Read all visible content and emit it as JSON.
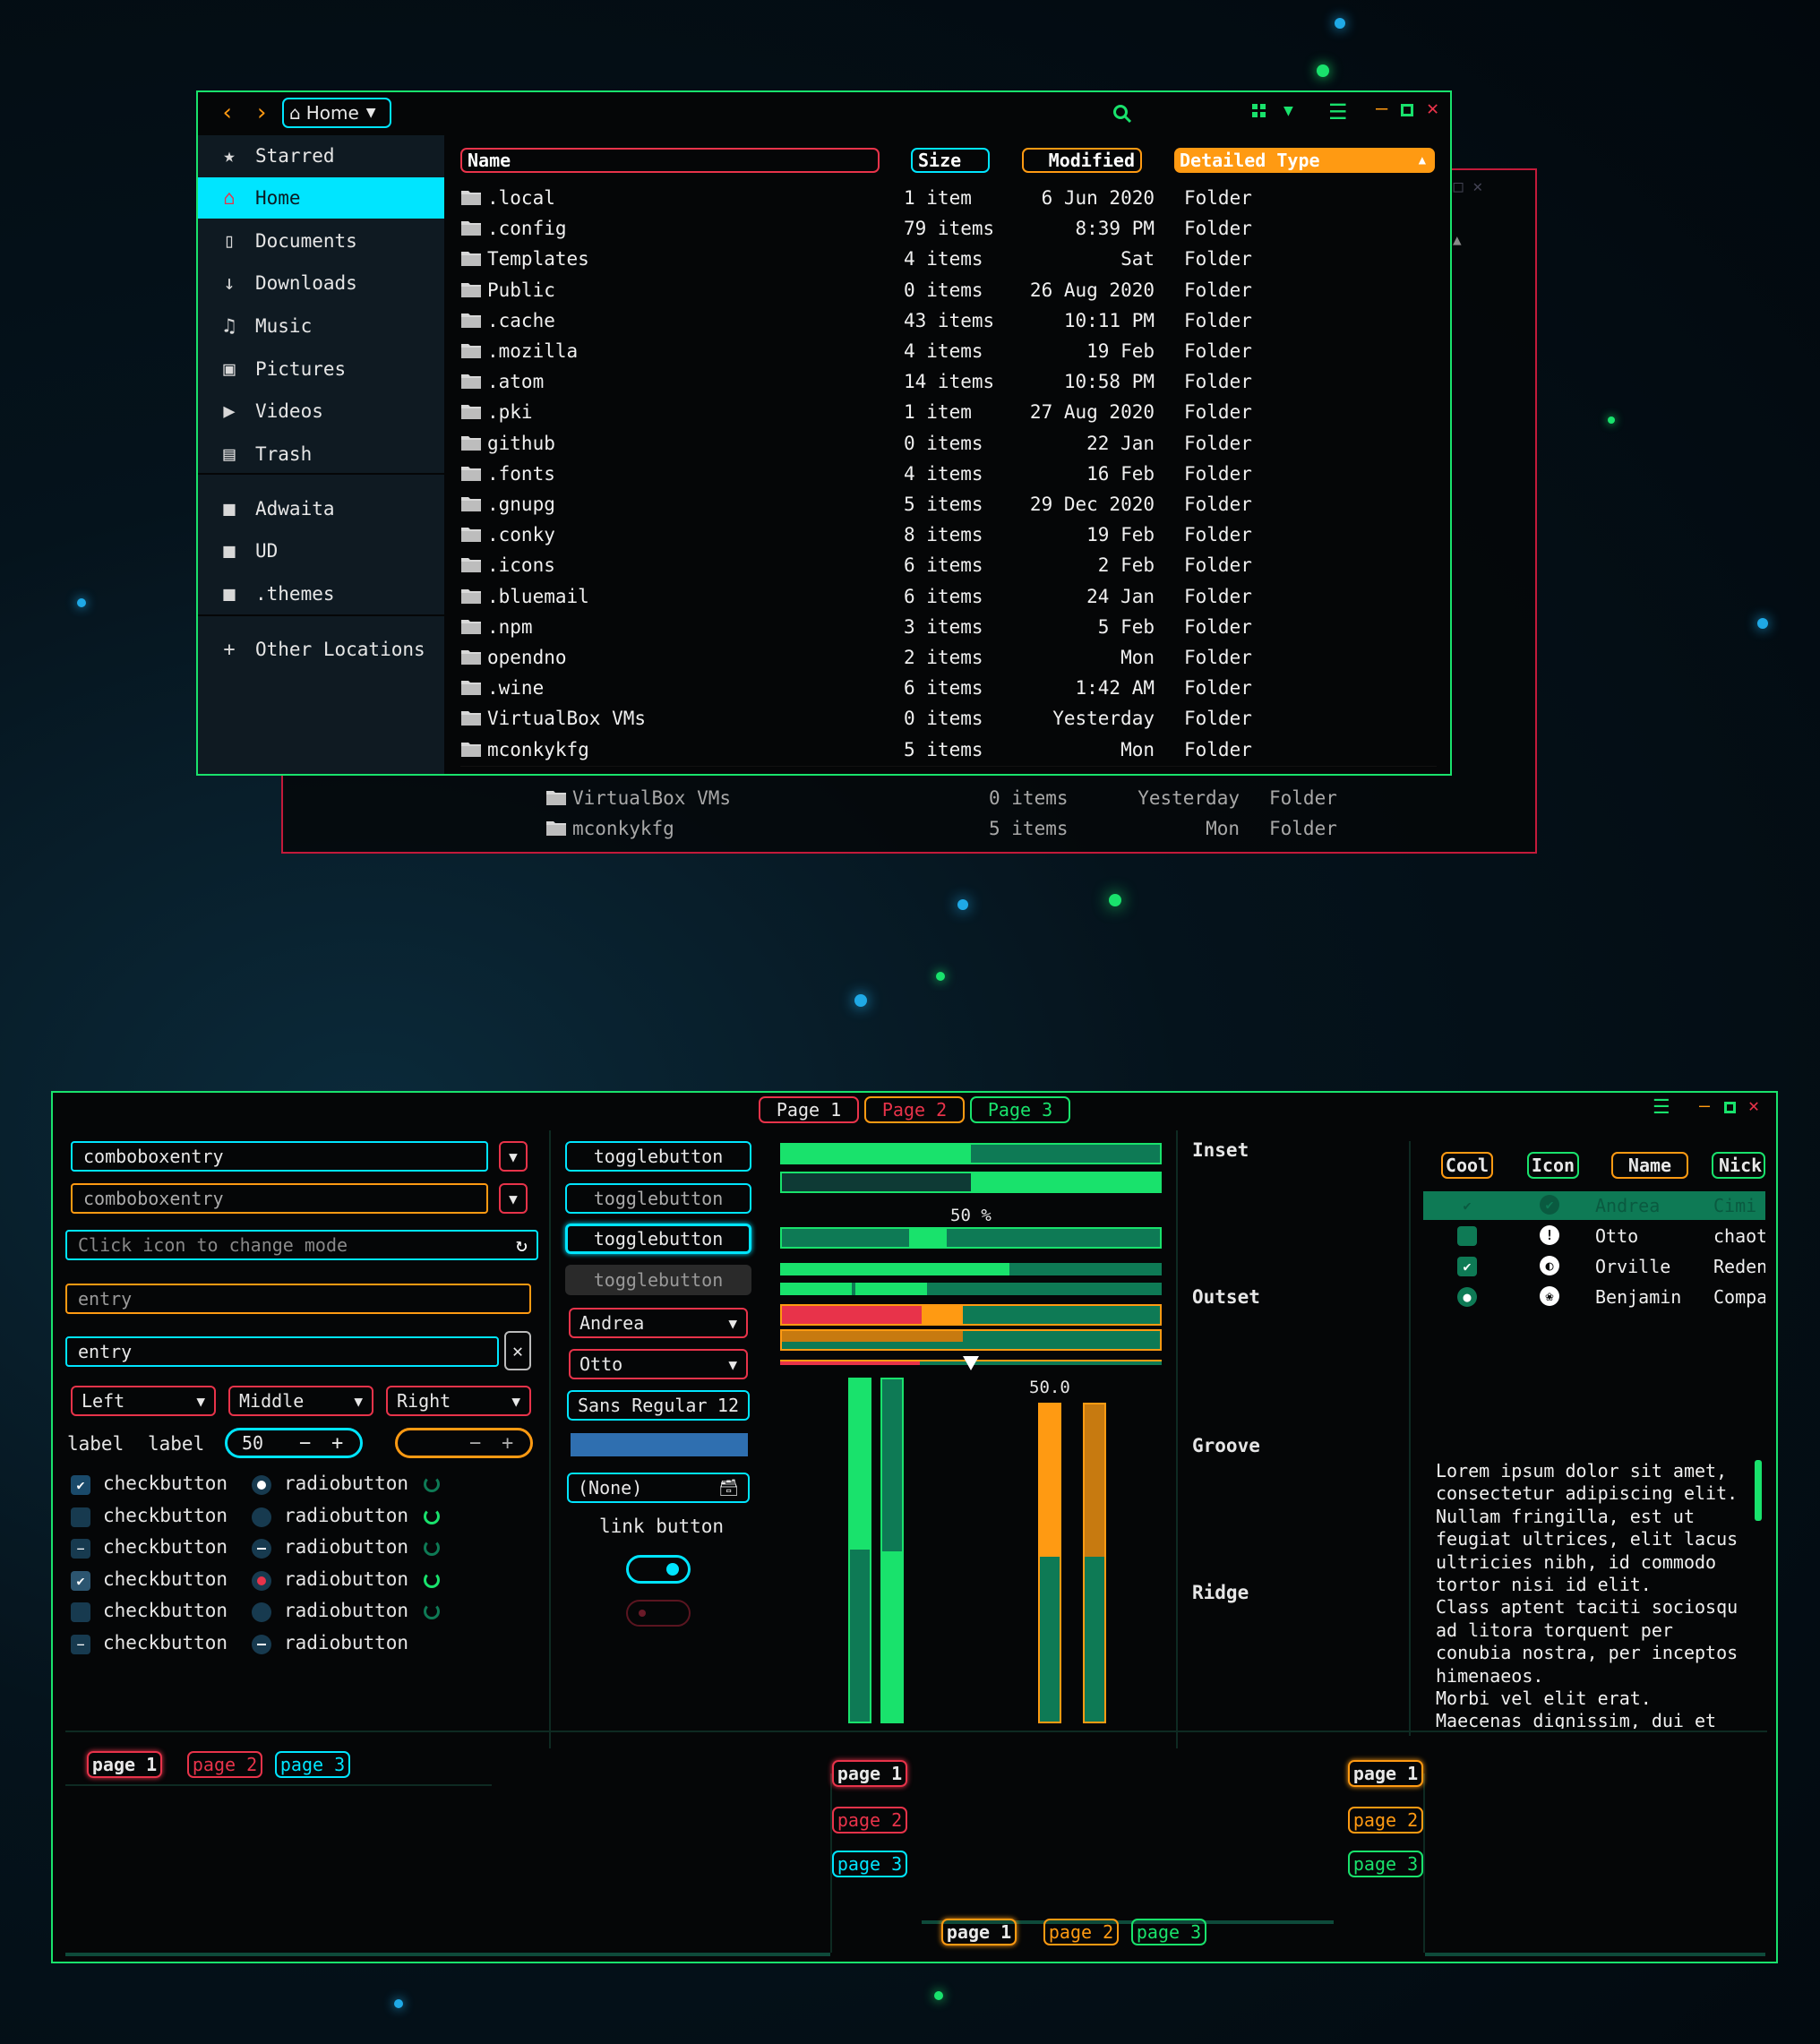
{
  "file_manager": {
    "nav": {
      "back": "back",
      "forward": "forward",
      "location": "Home"
    },
    "sidebar": [
      {
        "label": "Starred",
        "icon": "star-icon"
      },
      {
        "label": "Home",
        "icon": "home-icon"
      },
      {
        "label": "Documents",
        "icon": "document-icon"
      },
      {
        "label": "Downloads",
        "icon": "download-icon"
      },
      {
        "label": "Music",
        "icon": "music-icon"
      },
      {
        "label": "Pictures",
        "icon": "camera-icon"
      },
      {
        "label": "Videos",
        "icon": "video-icon"
      },
      {
        "label": "Trash",
        "icon": "trash-icon"
      },
      {
        "label": "Adwaita",
        "icon": "folder-icon"
      },
      {
        "label": "UD",
        "icon": "folder-icon"
      },
      {
        "label": ".themes",
        "icon": "folder-icon"
      },
      {
        "label": "Other Locations",
        "icon": "plus-icon"
      }
    ],
    "columns": {
      "name": "Name",
      "size": "Size",
      "modified": "Modified",
      "type": "Detailed Type"
    },
    "rows": [
      {
        "name": ".local",
        "size": "1 item",
        "modified": "6 Jun 2020",
        "type": "Folder"
      },
      {
        "name": ".config",
        "size": "79 items",
        "modified": "8:39 PM",
        "type": "Folder"
      },
      {
        "name": "Templates",
        "size": "4 items",
        "modified": "Sat",
        "type": "Folder"
      },
      {
        "name": "Public",
        "size": "0 items",
        "modified": "26 Aug 2020",
        "type": "Folder"
      },
      {
        "name": ".cache",
        "size": "43 items",
        "modified": "10:11 PM",
        "type": "Folder"
      },
      {
        "name": ".mozilla",
        "size": "4 items",
        "modified": "19 Feb",
        "type": "Folder"
      },
      {
        "name": ".atom",
        "size": "14 items",
        "modified": "10:58 PM",
        "type": "Folder"
      },
      {
        "name": ".pki",
        "size": "1 item",
        "modified": "27 Aug 2020",
        "type": "Folder"
      },
      {
        "name": "github",
        "size": "0 items",
        "modified": "22 Jan",
        "type": "Folder"
      },
      {
        "name": ".fonts",
        "size": "4 items",
        "modified": "16 Feb",
        "type": "Folder"
      },
      {
        "name": ".gnupg",
        "size": "5 items",
        "modified": "29 Dec 2020",
        "type": "Folder"
      },
      {
        "name": ".conky",
        "size": "8 items",
        "modified": "19 Feb",
        "type": "Folder"
      },
      {
        "name": ".icons",
        "size": "6 items",
        "modified": "2 Feb",
        "type": "Folder"
      },
      {
        "name": ".bluemail",
        "size": "6 items",
        "modified": "24 Jan",
        "type": "Folder"
      },
      {
        "name": ".npm",
        "size": "3 items",
        "modified": "5 Feb",
        "type": "Folder"
      },
      {
        "name": "opendno",
        "size": "2 items",
        "modified": "Mon",
        "type": "Folder"
      },
      {
        "name": ".wine",
        "size": "6 items",
        "modified": "1:42 AM",
        "type": "Folder"
      },
      {
        "name": "VirtualBox VMs",
        "size": "0 items",
        "modified": "Yesterday",
        "type": "Folder"
      },
      {
        "name": "mconkykfg",
        "size": "5 items",
        "modified": "Mon",
        "type": "Folder"
      }
    ],
    "ghost_rows": [
      {
        "name": "VirtualBox VMs",
        "size": "0 items",
        "modified": "Yesterday",
        "type": "Folder"
      },
      {
        "name": "mconkykfg",
        "size": "5 items",
        "modified": "Mon",
        "type": "Folder"
      }
    ]
  },
  "widgets": {
    "tabs": [
      "Page 1",
      "Page 2",
      "Page 3"
    ],
    "combo1": "comboboxentry",
    "combo2": "comboboxentry",
    "entry_icon_placeholder": "Click icon to change mode",
    "entry_placeholder": "entry",
    "entry_value": "entry",
    "align_combos": [
      "Left",
      "Middle",
      "Right"
    ],
    "labels": [
      "label",
      "label"
    ],
    "spin_value": "50",
    "check_label": "checkbutton",
    "radio_label": "radiobutton",
    "toggle_label": "togglebutton",
    "combo_andrea": "Andrea",
    "combo_otto": "Otto",
    "font_button": "Sans Regular",
    "font_size": "12",
    "file_button": "(None)",
    "link_button": "link button",
    "progress_text": "50 %",
    "scale_value": "50.0",
    "frame_labels": [
      "Inset",
      "Outset",
      "Groove",
      "Ridge"
    ],
    "tree_headers": [
      "Cool",
      "Icon",
      "Name",
      "Nick"
    ],
    "tree_rows": [
      {
        "name": "Andrea",
        "nick": "Cimi",
        "icon": "check-circle-icon"
      },
      {
        "name": "Otto",
        "nick": "chaot.",
        "icon": "warning-icon"
      },
      {
        "name": "Orville",
        "nick": "Redenl",
        "icon": "moon-icon"
      },
      {
        "name": "Benjamin",
        "nick": "Compa",
        "icon": "emblem-icon"
      }
    ],
    "lorem": "Lorem ipsum dolor sit amet,\nconsectetur adipiscing elit.\nNullam fringilla, est ut\nfeugiat ultrices, elit lacus\nultricies nibh, id commodo\ntortor nisi id elit.\nClass aptent taciti sociosqu\nad litora torquent per\nconubia nostra, per inceptos\nhimenaeos.\nMorbi vel elit erat.\nMaecenas dignissim, dui et",
    "notebook_tabs": [
      "page 1",
      "page 2",
      "page 3"
    ],
    "colors": {
      "green": "#19e26c",
      "cyan": "#00e5ff",
      "red": "#e8334a",
      "orange": "#ff9a12",
      "teal": "#0e7a55"
    },
    "progress_levels": [
      0.5,
      0.5,
      0.6
    ]
  }
}
